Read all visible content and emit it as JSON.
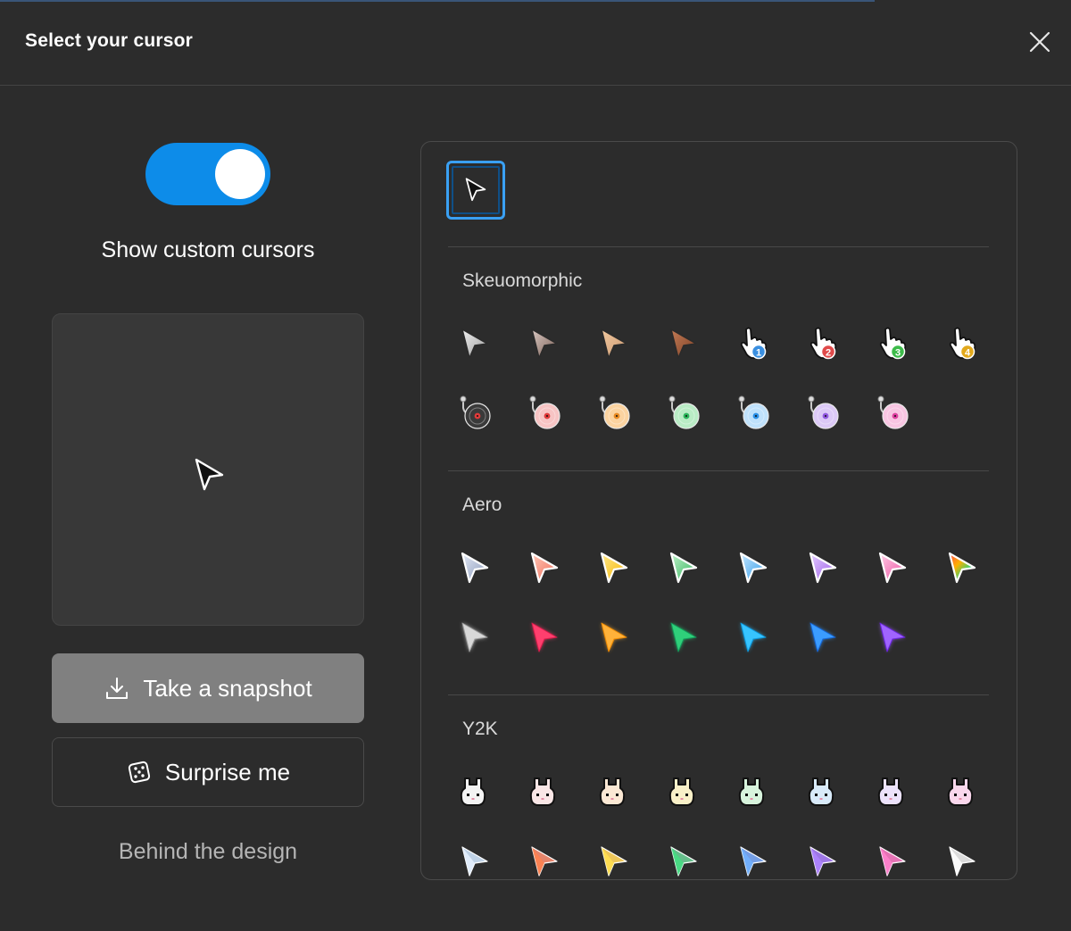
{
  "dialog": {
    "title": "Select your cursor"
  },
  "toggle": {
    "label": "Show custom cursors",
    "on": true,
    "color": "#0d8ce9"
  },
  "actions": {
    "snapshot_label": "Take a snapshot",
    "surprise_label": "Surprise me",
    "behind_label": "Behind the design"
  },
  "sections": [
    {
      "title": "Skeuomorphic",
      "rows": [
        [
          {
            "kind": "arrow",
            "c1": "#f0f0f0",
            "c2": "#9a9a9a"
          },
          {
            "kind": "arrow",
            "c1": "#d9c8c2",
            "c2": "#7a5f55"
          },
          {
            "kind": "arrow",
            "c1": "#f2c9a0",
            "c2": "#c99870"
          },
          {
            "kind": "arrow",
            "c1": "#c27a55",
            "c2": "#7d4126"
          },
          {
            "kind": "hand",
            "badge": "1",
            "c1": "#3a8fe0"
          },
          {
            "kind": "hand",
            "badge": "2",
            "c1": "#e04a4a"
          },
          {
            "kind": "hand",
            "badge": "3",
            "c1": "#3dbb4a"
          },
          {
            "kind": "hand",
            "badge": "4",
            "c1": "#e2a91c"
          }
        ],
        [
          {
            "kind": "disc",
            "c1": "#3a3a3a",
            "c2": "#e03a3a"
          },
          {
            "kind": "disc",
            "c1": "#f7c4c4",
            "c2": "#e03a3a"
          },
          {
            "kind": "disc",
            "c1": "#fbd3a0",
            "c2": "#e78a23"
          },
          {
            "kind": "disc",
            "c1": "#b9ecc5",
            "c2": "#2bb45a"
          },
          {
            "kind": "disc",
            "c1": "#bfe1fb",
            "c2": "#2a8fe5"
          },
          {
            "kind": "disc",
            "c1": "#dcc9f7",
            "c2": "#9158e0"
          },
          {
            "kind": "disc",
            "c1": "#f8c5e2",
            "c2": "#de3fa0"
          }
        ]
      ]
    },
    {
      "title": "Aero",
      "rows": [
        [
          {
            "kind": "aero",
            "c1": "#e3e9f5",
            "c2": "#8796b8"
          },
          {
            "kind": "aero",
            "c1": "#ffc7b8",
            "c2": "#ef6a55"
          },
          {
            "kind": "aero",
            "c1": "#ffe88a",
            "c2": "#f5b400"
          },
          {
            "kind": "aero",
            "c1": "#bff0c9",
            "c2": "#2fb35a"
          },
          {
            "kind": "aero",
            "c1": "#c5e6ff",
            "c2": "#2e9ae8"
          },
          {
            "kind": "aero",
            "c1": "#e3ccff",
            "c2": "#9b5ae8"
          },
          {
            "kind": "aero",
            "c1": "#ffcde6",
            "c2": "#ec4c9f"
          },
          {
            "kind": "rainbow",
            "c1": "#ff4b4b",
            "c2": "#3b8cff"
          }
        ],
        [
          {
            "kind": "glow",
            "c1": "#d8d8d8",
            "c2": "#9a9a9a"
          },
          {
            "kind": "glow",
            "c1": "#ff3f6e",
            "c2": "#d81b4a"
          },
          {
            "kind": "glow",
            "c1": "#ffb23a",
            "c2": "#f08a00"
          },
          {
            "kind": "glow",
            "c1": "#2fd07a",
            "c2": "#14995a"
          },
          {
            "kind": "glow",
            "c1": "#37c4ff",
            "c2": "#0b97dd"
          },
          {
            "kind": "glow",
            "c1": "#3b9cff",
            "c2": "#1565d6"
          },
          {
            "kind": "glow",
            "c1": "#a064ff",
            "c2": "#6a24e0"
          }
        ]
      ]
    },
    {
      "title": "Y2K",
      "rows": [
        [
          {
            "kind": "bunny",
            "c1": "#f3f3f3"
          },
          {
            "kind": "bunny",
            "c1": "#f9e6e6"
          },
          {
            "kind": "bunny",
            "c1": "#fbe8d4"
          },
          {
            "kind": "bunny",
            "c1": "#f9f0c8"
          },
          {
            "kind": "bunny",
            "c1": "#d7f3dc"
          },
          {
            "kind": "bunny",
            "c1": "#d8eaf9"
          },
          {
            "kind": "bunny",
            "c1": "#ece2fb"
          },
          {
            "kind": "bunny",
            "c1": "#f9d7ec"
          }
        ],
        [
          {
            "kind": "gem",
            "c1": "#e8f2ff",
            "c2": "#9cb8d8"
          },
          {
            "kind": "gem",
            "c1": "#ff8a5a",
            "c2": "#d8431c"
          },
          {
            "kind": "gem",
            "c1": "#ffe15a",
            "c2": "#e3a800"
          },
          {
            "kind": "gem",
            "c1": "#4fe08a",
            "c2": "#149a4d"
          },
          {
            "kind": "gem",
            "c1": "#79b6ff",
            "c2": "#2a6ad8"
          },
          {
            "kind": "gem",
            "c1": "#b48cff",
            "c2": "#6a2fd8"
          },
          {
            "kind": "gem",
            "c1": "#ff8ad0",
            "c2": "#d8288e"
          },
          {
            "kind": "gem",
            "c1": "#ffffff",
            "c2": "#c8c8c8"
          }
        ]
      ]
    }
  ]
}
